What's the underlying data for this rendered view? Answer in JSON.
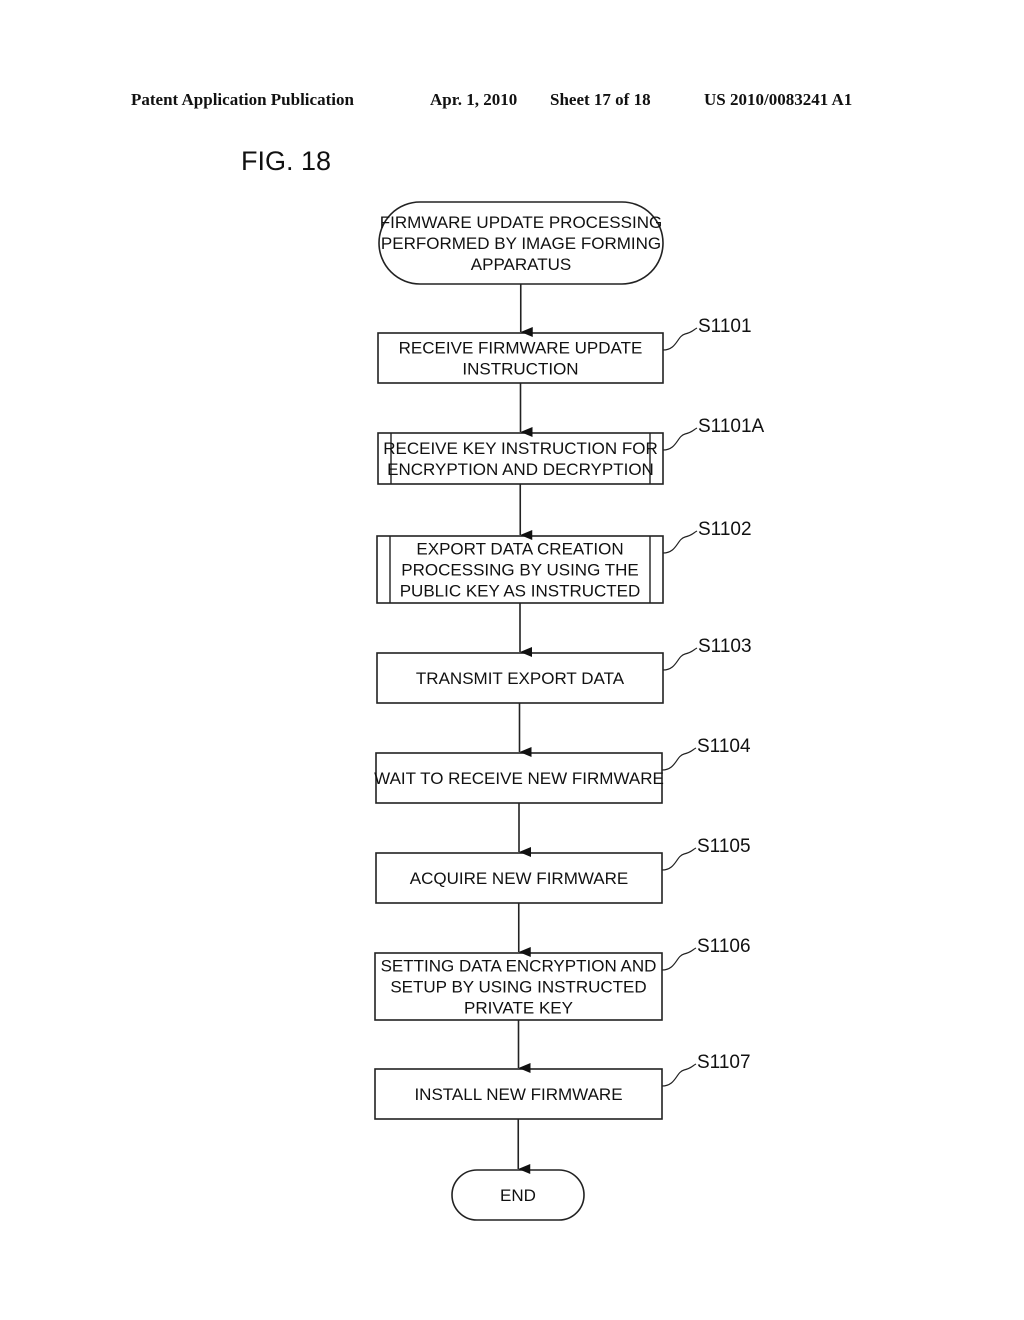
{
  "header": {
    "publication": "Patent Application Publication",
    "date": "Apr. 1, 2010",
    "sheet": "Sheet 17 of 18",
    "number": "US 2010/0083241 A1"
  },
  "figure_title": "FIG. 18",
  "flowchart": {
    "start": {
      "lines": [
        "FIRMWARE UPDATE PROCESSING",
        "PERFORMED BY IMAGE FORMING",
        "APPARATUS"
      ]
    },
    "steps": [
      {
        "id": "S1101",
        "type": "process",
        "lines": [
          "RECEIVE FIRMWARE UPDATE",
          "INSTRUCTION"
        ]
      },
      {
        "id": "S1101A",
        "type": "subroutine",
        "lines": [
          "RECEIVE KEY INSTRUCTION FOR",
          "ENCRYPTION AND DECRYPTION"
        ]
      },
      {
        "id": "S1102",
        "type": "subroutine",
        "lines": [
          "EXPORT DATA CREATION",
          "PROCESSING BY USING THE",
          "PUBLIC KEY AS INSTRUCTED"
        ]
      },
      {
        "id": "S1103",
        "type": "process",
        "lines": [
          "TRANSMIT EXPORT DATA"
        ]
      },
      {
        "id": "S1104",
        "type": "process",
        "lines": [
          "WAIT TO RECEIVE NEW FIRMWARE"
        ]
      },
      {
        "id": "S1105",
        "type": "process",
        "lines": [
          "ACQUIRE NEW FIRMWARE"
        ]
      },
      {
        "id": "S1106",
        "type": "process",
        "lines": [
          "SETTING DATA ENCRYPTION AND",
          "SETUP BY USING INSTRUCTED",
          "PRIVATE KEY"
        ]
      },
      {
        "id": "S1107",
        "type": "process",
        "lines": [
          "INSTALL NEW FIRMWARE"
        ]
      }
    ],
    "end": {
      "lines": [
        "END"
      ]
    }
  }
}
